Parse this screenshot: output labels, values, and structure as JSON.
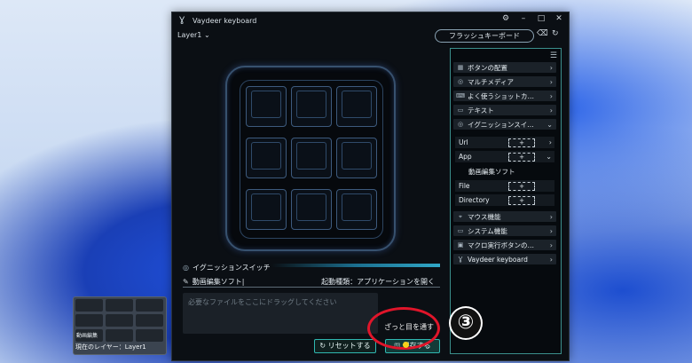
{
  "window": {
    "title": "Vaydeer keyboard",
    "layer_selected": "Layer1",
    "flash_keyboard_label": "フラッシュキーボード"
  },
  "editor": {
    "section_title": "イグニッションスイッチ",
    "shortcut_name": "動画編集ソフト|",
    "launch_type": "起動種類：アプリケーションを開く",
    "drop_placeholder": "必要なファイルをここにドラッグしてください",
    "tooltip_text": "ざっと目を通す",
    "reset_label": "リセットする",
    "save_label": "保存する"
  },
  "panel": {
    "categories": [
      {
        "label": "ボタンの配置",
        "icon": "grid-icon",
        "arrow": ">"
      },
      {
        "label": "マルチメディア",
        "icon": "media-icon",
        "arrow": ">"
      },
      {
        "label": "よく使うショットカ…",
        "icon": "keyboard-icon",
        "arrow": ">"
      },
      {
        "label": "テキスト",
        "icon": "text-icon",
        "arrow": ">"
      },
      {
        "label": "イグニッションスイ…",
        "icon": "ignition-icon",
        "arrow": "v"
      }
    ],
    "ignition_items": [
      {
        "label": "Url",
        "plus": "+",
        "arrow": ">"
      },
      {
        "label": "App",
        "plus": "+",
        "arrow": "v"
      }
    ],
    "app_entry": "動画編集ソフト",
    "file_items": [
      {
        "label": "File",
        "plus": "+"
      },
      {
        "label": "Directory",
        "plus": "+"
      }
    ],
    "more_categories": [
      {
        "label": "マウス機能",
        "icon": "mouse-icon",
        "arrow": ">"
      },
      {
        "label": "システム機能",
        "icon": "monitor-icon",
        "arrow": ">"
      },
      {
        "label": "マクロ実行ボタンの…",
        "icon": "macro-icon",
        "arrow": ">"
      },
      {
        "label": "Vaydeer keyboard",
        "icon": "vaydeer-icon",
        "arrow": ">"
      }
    ]
  },
  "mini_layer": {
    "key_label": "動画編集",
    "layer_text": "現在のレイヤー：Layer1"
  },
  "annotation": {
    "step_number": "③"
  }
}
